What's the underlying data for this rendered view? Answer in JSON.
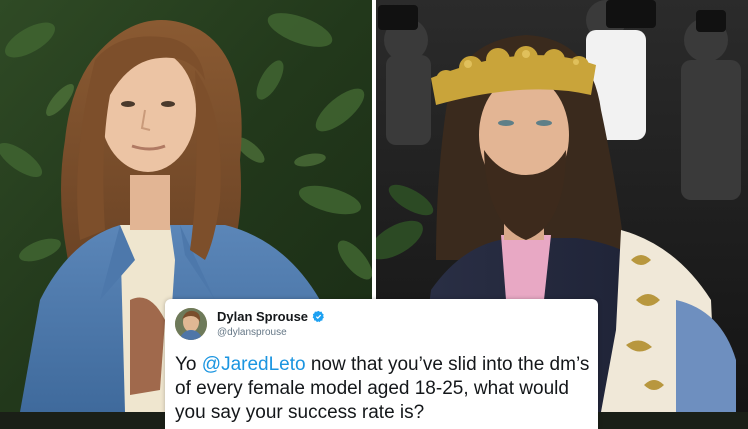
{
  "tweet": {
    "display_name": "Dylan Sprouse",
    "handle": "@dylansprouse",
    "verified": true,
    "text_before_mention": "Yo ",
    "mention": "@JaredLeto",
    "text_after_mention": " now that you’ve slid into the dm’s of every female model aged 18-25, what would you say your success rate is?"
  },
  "colors": {
    "mention": "#1b95e0",
    "verified_badge": "#1da1f2",
    "crown_gold": "#c9a43a"
  },
  "icons": {
    "verified": "verified-badge-icon"
  }
}
